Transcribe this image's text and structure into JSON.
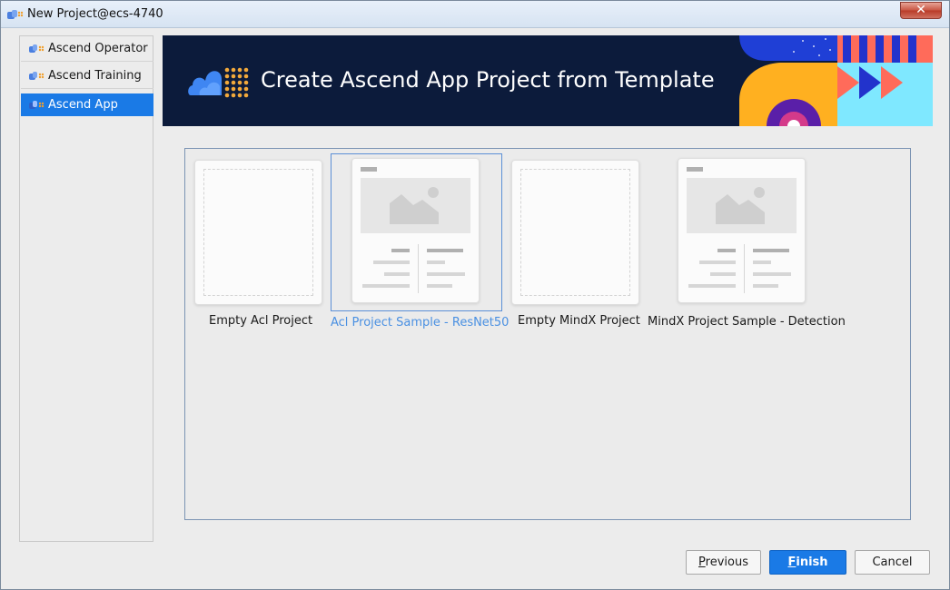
{
  "window": {
    "title": "New Project@ecs-4740",
    "close_label": "✕"
  },
  "sidebar": {
    "items": [
      {
        "label": "Ascend Operator",
        "selected": false
      },
      {
        "label": "Ascend Training",
        "selected": false
      },
      {
        "label": "Ascend App",
        "selected": true
      }
    ]
  },
  "banner": {
    "title": "Create Ascend App Project from Template"
  },
  "templates": [
    {
      "label": "Empty Acl Project",
      "style": "empty",
      "selected": false
    },
    {
      "label": "Acl Project Sample - ResNet50",
      "style": "sample",
      "selected": true
    },
    {
      "label": "Empty MindX Project",
      "style": "empty",
      "selected": false
    },
    {
      "label": "MindX Project Sample - Detection",
      "style": "sample",
      "selected": false
    }
  ],
  "buttons": {
    "previous": {
      "mnemonic": "P",
      "rest": "revious"
    },
    "finish": {
      "mnemonic": "F",
      "rest": "inish"
    },
    "cancel": "Cancel"
  },
  "colors": {
    "accent": "#1a7ae6",
    "banner_bg": "#0c1b3b",
    "selected_caption": "#4a90e2"
  }
}
